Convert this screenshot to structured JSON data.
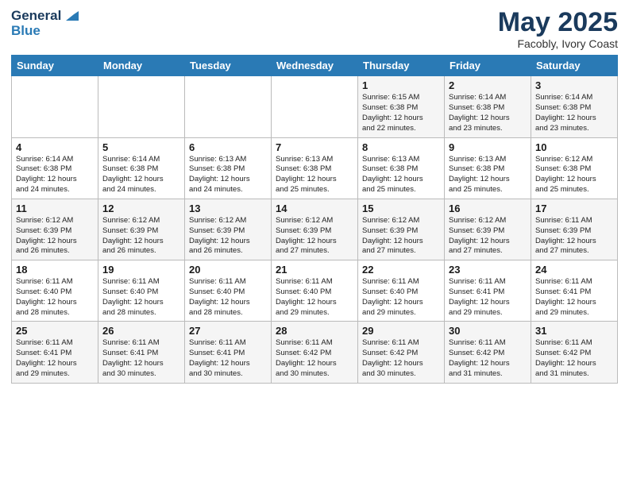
{
  "header": {
    "logo_line1": "General",
    "logo_line2": "Blue",
    "month_year": "May 2025",
    "location": "Facobly, Ivory Coast"
  },
  "weekdays": [
    "Sunday",
    "Monday",
    "Tuesday",
    "Wednesday",
    "Thursday",
    "Friday",
    "Saturday"
  ],
  "weeks": [
    [
      {
        "day": "",
        "info": ""
      },
      {
        "day": "",
        "info": ""
      },
      {
        "day": "",
        "info": ""
      },
      {
        "day": "",
        "info": ""
      },
      {
        "day": "1",
        "info": "Sunrise: 6:15 AM\nSunset: 6:38 PM\nDaylight: 12 hours\nand 22 minutes."
      },
      {
        "day": "2",
        "info": "Sunrise: 6:14 AM\nSunset: 6:38 PM\nDaylight: 12 hours\nand 23 minutes."
      },
      {
        "day": "3",
        "info": "Sunrise: 6:14 AM\nSunset: 6:38 PM\nDaylight: 12 hours\nand 23 minutes."
      }
    ],
    [
      {
        "day": "4",
        "info": "Sunrise: 6:14 AM\nSunset: 6:38 PM\nDaylight: 12 hours\nand 24 minutes."
      },
      {
        "day": "5",
        "info": "Sunrise: 6:14 AM\nSunset: 6:38 PM\nDaylight: 12 hours\nand 24 minutes."
      },
      {
        "day": "6",
        "info": "Sunrise: 6:13 AM\nSunset: 6:38 PM\nDaylight: 12 hours\nand 24 minutes."
      },
      {
        "day": "7",
        "info": "Sunrise: 6:13 AM\nSunset: 6:38 PM\nDaylight: 12 hours\nand 25 minutes."
      },
      {
        "day": "8",
        "info": "Sunrise: 6:13 AM\nSunset: 6:38 PM\nDaylight: 12 hours\nand 25 minutes."
      },
      {
        "day": "9",
        "info": "Sunrise: 6:13 AM\nSunset: 6:38 PM\nDaylight: 12 hours\nand 25 minutes."
      },
      {
        "day": "10",
        "info": "Sunrise: 6:12 AM\nSunset: 6:38 PM\nDaylight: 12 hours\nand 25 minutes."
      }
    ],
    [
      {
        "day": "11",
        "info": "Sunrise: 6:12 AM\nSunset: 6:39 PM\nDaylight: 12 hours\nand 26 minutes."
      },
      {
        "day": "12",
        "info": "Sunrise: 6:12 AM\nSunset: 6:39 PM\nDaylight: 12 hours\nand 26 minutes."
      },
      {
        "day": "13",
        "info": "Sunrise: 6:12 AM\nSunset: 6:39 PM\nDaylight: 12 hours\nand 26 minutes."
      },
      {
        "day": "14",
        "info": "Sunrise: 6:12 AM\nSunset: 6:39 PM\nDaylight: 12 hours\nand 27 minutes."
      },
      {
        "day": "15",
        "info": "Sunrise: 6:12 AM\nSunset: 6:39 PM\nDaylight: 12 hours\nand 27 minutes."
      },
      {
        "day": "16",
        "info": "Sunrise: 6:12 AM\nSunset: 6:39 PM\nDaylight: 12 hours\nand 27 minutes."
      },
      {
        "day": "17",
        "info": "Sunrise: 6:11 AM\nSunset: 6:39 PM\nDaylight: 12 hours\nand 27 minutes."
      }
    ],
    [
      {
        "day": "18",
        "info": "Sunrise: 6:11 AM\nSunset: 6:40 PM\nDaylight: 12 hours\nand 28 minutes."
      },
      {
        "day": "19",
        "info": "Sunrise: 6:11 AM\nSunset: 6:40 PM\nDaylight: 12 hours\nand 28 minutes."
      },
      {
        "day": "20",
        "info": "Sunrise: 6:11 AM\nSunset: 6:40 PM\nDaylight: 12 hours\nand 28 minutes."
      },
      {
        "day": "21",
        "info": "Sunrise: 6:11 AM\nSunset: 6:40 PM\nDaylight: 12 hours\nand 29 minutes."
      },
      {
        "day": "22",
        "info": "Sunrise: 6:11 AM\nSunset: 6:40 PM\nDaylight: 12 hours\nand 29 minutes."
      },
      {
        "day": "23",
        "info": "Sunrise: 6:11 AM\nSunset: 6:41 PM\nDaylight: 12 hours\nand 29 minutes."
      },
      {
        "day": "24",
        "info": "Sunrise: 6:11 AM\nSunset: 6:41 PM\nDaylight: 12 hours\nand 29 minutes."
      }
    ],
    [
      {
        "day": "25",
        "info": "Sunrise: 6:11 AM\nSunset: 6:41 PM\nDaylight: 12 hours\nand 29 minutes."
      },
      {
        "day": "26",
        "info": "Sunrise: 6:11 AM\nSunset: 6:41 PM\nDaylight: 12 hours\nand 30 minutes."
      },
      {
        "day": "27",
        "info": "Sunrise: 6:11 AM\nSunset: 6:41 PM\nDaylight: 12 hours\nand 30 minutes."
      },
      {
        "day": "28",
        "info": "Sunrise: 6:11 AM\nSunset: 6:42 PM\nDaylight: 12 hours\nand 30 minutes."
      },
      {
        "day": "29",
        "info": "Sunrise: 6:11 AM\nSunset: 6:42 PM\nDaylight: 12 hours\nand 30 minutes."
      },
      {
        "day": "30",
        "info": "Sunrise: 6:11 AM\nSunset: 6:42 PM\nDaylight: 12 hours\nand 31 minutes."
      },
      {
        "day": "31",
        "info": "Sunrise: 6:11 AM\nSunset: 6:42 PM\nDaylight: 12 hours\nand 31 minutes."
      }
    ]
  ]
}
